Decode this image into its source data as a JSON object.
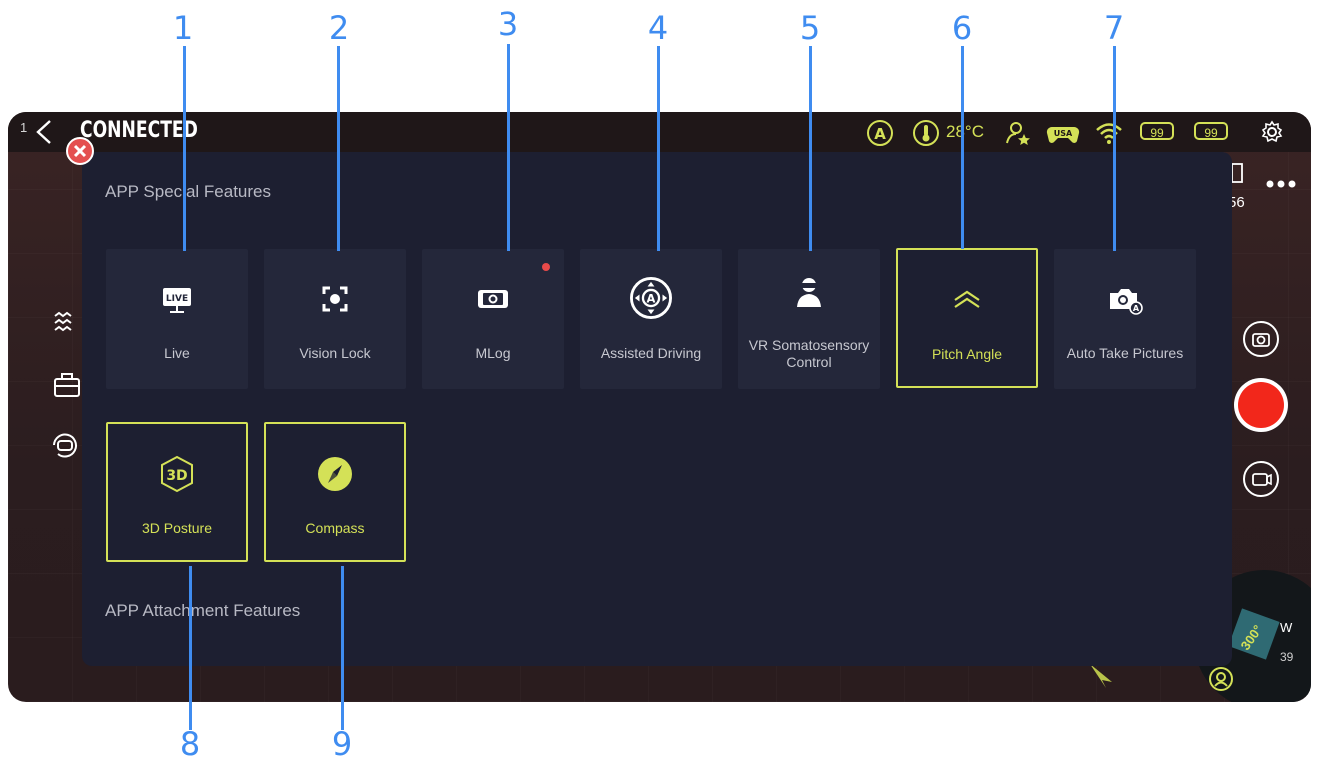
{
  "callouts": [
    "1",
    "2",
    "3",
    "4",
    "5",
    "6",
    "7",
    "8",
    "9"
  ],
  "topbar": {
    "index": "1",
    "status": "CONNECTED",
    "temperature": "28°C",
    "battery_left": "99",
    "battery_right": "99",
    "mode_letter": "A",
    "region": "USA"
  },
  "right_panel": {
    "counter": "56"
  },
  "map": {
    "heading": "300°",
    "direction": "W",
    "distance": "39"
  },
  "panel": {
    "special_title": "APP Special Features",
    "attachment_title": "APP Attachment Features",
    "live_badge": "LIVE",
    "features": [
      {
        "label": "Live",
        "icon": "live-icon",
        "active": false
      },
      {
        "label": "Vision Lock",
        "icon": "vision-lock-icon",
        "active": false
      },
      {
        "label": "MLog",
        "icon": "mlog-icon",
        "active": false
      },
      {
        "label": "Assisted Driving",
        "icon": "assisted-driving-icon",
        "active": false
      },
      {
        "label": "VR Somatosensory Control",
        "icon": "vr-headset-icon",
        "active": false
      },
      {
        "label": "Pitch Angle",
        "icon": "pitch-angle-icon",
        "active": true
      },
      {
        "label": "Auto Take Pictures",
        "icon": "auto-camera-icon",
        "active": false
      },
      {
        "label": "3D Posture",
        "icon": "3d-posture-icon",
        "active": true
      },
      {
        "label": "Compass",
        "icon": "compass-icon",
        "active": true
      }
    ],
    "posture_badge": "3D"
  },
  "colors": {
    "accent": "#d4e157",
    "callout": "#3f8cf0",
    "panel_bg": "#1d1f31",
    "card_bg": "#24273a",
    "record": "#f2271b",
    "close": "#e45050"
  }
}
